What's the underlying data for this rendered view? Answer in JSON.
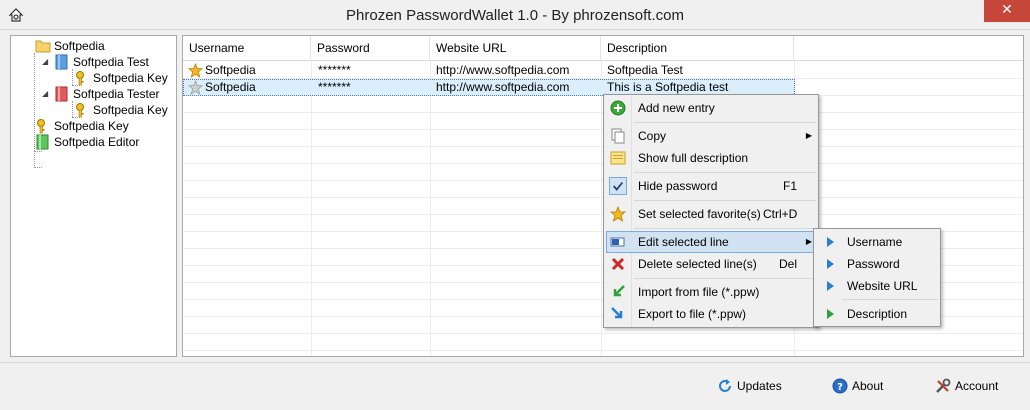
{
  "window": {
    "title": "Phrozen PasswordWallet 1.0 - By phrozensoft.com",
    "close_glyph": "✕"
  },
  "tree": {
    "items": [
      {
        "label": "Softpedia",
        "icon": "folder-icon"
      },
      {
        "label": "Softpedia Test",
        "icon": "folder-blue-icon"
      },
      {
        "label": "Softpedia Key",
        "icon": "key-icon"
      },
      {
        "label": "Softpedia Tester",
        "icon": "folder-red-icon"
      },
      {
        "label": "Softpedia Key",
        "icon": "key-icon"
      },
      {
        "label": "Softpedia Key",
        "icon": "key-icon"
      },
      {
        "label": "Softpedia Editor",
        "icon": "folder-green-icon"
      }
    ],
    "toggle_glyph": "◢"
  },
  "grid": {
    "columns": [
      "Username",
      "Password",
      "Website URL",
      "Description"
    ],
    "rows": [
      {
        "username": "Softpedia",
        "password": "*******",
        "url": "http://www.softpedia.com",
        "description": "Softpedia Test",
        "favorite": true
      },
      {
        "username": "Softpedia",
        "password": "*******",
        "url": "http://www.softpedia.com",
        "description": "This is a Softpedia test",
        "favorite": false
      }
    ]
  },
  "context_menu": {
    "items": [
      {
        "label": "Add new entry",
        "icon": "add-icon"
      },
      {
        "label": "Copy",
        "icon": "copy-icon",
        "arrow": "▶"
      },
      {
        "label": "Show full description",
        "icon": "note-icon"
      },
      {
        "label": "Hide password",
        "icon": "check-icon",
        "shortcut": "F1",
        "checked": true
      },
      {
        "label": "Set selected favorite(s)",
        "icon": "star-icon",
        "shortcut": "Ctrl+D"
      },
      {
        "label": "Edit selected line",
        "icon": "edit-icon",
        "arrow": "▶",
        "highlighted": true
      },
      {
        "label": "Delete selected line(s)",
        "icon": "delete-icon",
        "shortcut": "Del"
      },
      {
        "label": "Import from file (*.ppw)",
        "icon": "import-icon"
      },
      {
        "label": "Export to file (*.ppw)",
        "icon": "export-icon"
      }
    ]
  },
  "edit_submenu": {
    "items": [
      {
        "label": "Username",
        "icon": "arrow-right-icon"
      },
      {
        "label": "Password",
        "icon": "arrow-right-icon"
      },
      {
        "label": "Website URL",
        "icon": "arrow-right-icon"
      },
      {
        "label": "Description",
        "icon": "arrow-right-green-icon"
      }
    ]
  },
  "bottom_bar": {
    "updates_label": "Updates",
    "about_label": "About",
    "account_label": "Account"
  },
  "colors": {
    "selection": "#dbeefb",
    "menu_highlight": "#d1e2f2",
    "close_button": "#c7463a"
  }
}
